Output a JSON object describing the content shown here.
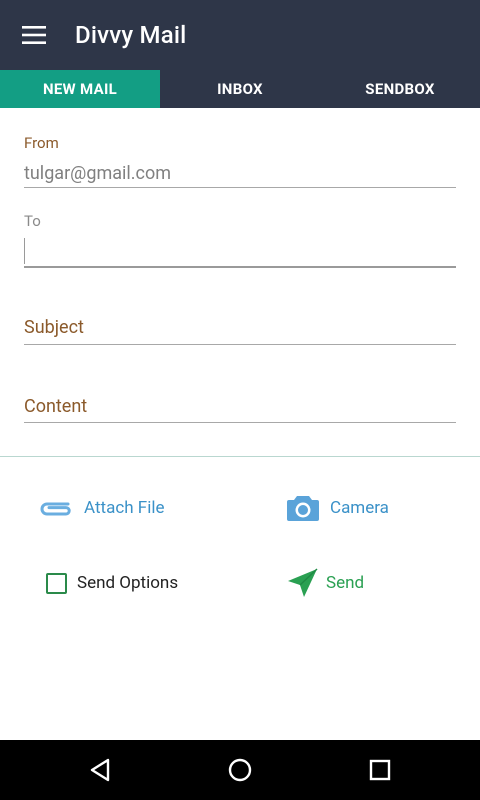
{
  "app": {
    "title": "Divvy Mail"
  },
  "tabs": [
    {
      "label": "NEW MAIL",
      "active": true
    },
    {
      "label": "INBOX",
      "active": false
    },
    {
      "label": "SENDBOX",
      "active": false
    }
  ],
  "form": {
    "from_label": "From",
    "from_value": "tulgar@gmail.com",
    "to_label": "To",
    "to_value": "",
    "subject_placeholder": "Subject",
    "content_placeholder": "Content"
  },
  "actions": {
    "attach_label": "Attach File",
    "camera_label": "Camera",
    "send_options_label": "Send Options",
    "send_options_checked": false,
    "send_label": "Send"
  },
  "icons": {
    "menu": "hamburger-icon",
    "attach": "paperclip-icon",
    "camera": "camera-icon",
    "send": "send-icon",
    "back": "back-icon",
    "home": "home-icon",
    "recent": "recent-apps-icon"
  },
  "colors": {
    "appbar": "#2e3648",
    "active_tab": "#139e84",
    "label_brown": "#8b5a2b",
    "action_blue": "#3a91c8",
    "send_green": "#2aa052",
    "checkbox_green": "#2a8a4a"
  }
}
